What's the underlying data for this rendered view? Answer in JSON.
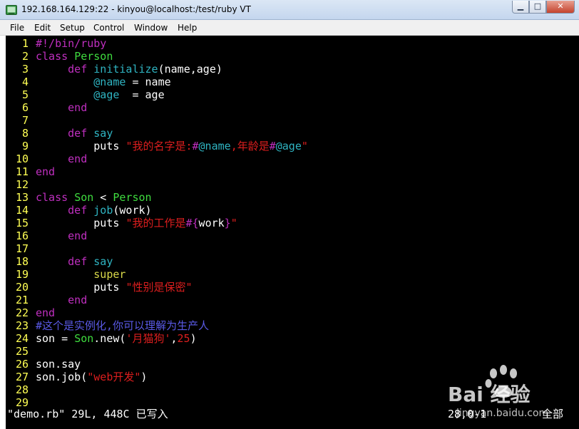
{
  "window": {
    "title": "192.168.164.129:22 - kinyou@localhost:/test/ruby VT",
    "minimize_glyph": "▁",
    "maximize_glyph": "□",
    "close_glyph": "✕",
    "app_icon": "terminal-icon"
  },
  "menu": [
    "File",
    "Edit",
    "Setup",
    "Control",
    "Window",
    "Help"
  ],
  "editor": {
    "lines": [
      {
        "n": "1",
        "spans": [
          {
            "t": "#!/bin/ruby",
            "c": "kw"
          }
        ]
      },
      {
        "n": "2",
        "spans": [
          {
            "t": "class ",
            "c": "kw"
          },
          {
            "t": "Person",
            "c": "type"
          }
        ]
      },
      {
        "n": "3",
        "spans": [
          {
            "t": "     "
          },
          {
            "t": "def ",
            "c": "kw"
          },
          {
            "t": "initialize",
            "c": "fn"
          },
          {
            "t": "(name,age)",
            "c": "dflt"
          }
        ]
      },
      {
        "n": "4",
        "spans": [
          {
            "t": "         "
          },
          {
            "t": "@name",
            "c": "ivar"
          },
          {
            "t": " = name",
            "c": "dflt"
          }
        ]
      },
      {
        "n": "5",
        "spans": [
          {
            "t": "         "
          },
          {
            "t": "@age",
            "c": "ivar"
          },
          {
            "t": "  = age",
            "c": "dflt"
          }
        ]
      },
      {
        "n": "6",
        "spans": [
          {
            "t": "     "
          },
          {
            "t": "end",
            "c": "kw"
          }
        ]
      },
      {
        "n": "7",
        "spans": []
      },
      {
        "n": "8",
        "spans": [
          {
            "t": "     "
          },
          {
            "t": "def ",
            "c": "kw"
          },
          {
            "t": "say",
            "c": "fn"
          }
        ]
      },
      {
        "n": "9",
        "spans": [
          {
            "t": "         "
          },
          {
            "t": "puts ",
            "c": "dflt"
          },
          {
            "t": "\"我的名字是:",
            "c": "str"
          },
          {
            "t": "#",
            "c": "interp"
          },
          {
            "t": "@name",
            "c": "ivar"
          },
          {
            "t": ",年龄是",
            "c": "str"
          },
          {
            "t": "#",
            "c": "interp"
          },
          {
            "t": "@age",
            "c": "ivar"
          },
          {
            "t": "\"",
            "c": "str"
          }
        ]
      },
      {
        "n": "10",
        "spans": [
          {
            "t": "     "
          },
          {
            "t": "end",
            "c": "kw"
          }
        ]
      },
      {
        "n": "11",
        "spans": [
          {
            "t": "end",
            "c": "kw"
          }
        ]
      },
      {
        "n": "12",
        "spans": []
      },
      {
        "n": "13",
        "spans": [
          {
            "t": "class ",
            "c": "kw"
          },
          {
            "t": "Son",
            "c": "type"
          },
          {
            "t": " < ",
            "c": "dflt"
          },
          {
            "t": "Person",
            "c": "type"
          }
        ]
      },
      {
        "n": "14",
        "spans": [
          {
            "t": "     "
          },
          {
            "t": "def ",
            "c": "kw"
          },
          {
            "t": "job",
            "c": "fn"
          },
          {
            "t": "(work)",
            "c": "dflt"
          }
        ]
      },
      {
        "n": "15",
        "spans": [
          {
            "t": "         "
          },
          {
            "t": "puts ",
            "c": "dflt"
          },
          {
            "t": "\"我的工作是",
            "c": "str"
          },
          {
            "t": "#{",
            "c": "interp"
          },
          {
            "t": "work",
            "c": "dflt"
          },
          {
            "t": "}",
            "c": "interp"
          },
          {
            "t": "\"",
            "c": "str"
          }
        ]
      },
      {
        "n": "16",
        "spans": [
          {
            "t": "     "
          },
          {
            "t": "end",
            "c": "kw"
          }
        ]
      },
      {
        "n": "17",
        "spans": []
      },
      {
        "n": "18",
        "spans": [
          {
            "t": "     "
          },
          {
            "t": "def ",
            "c": "kw"
          },
          {
            "t": "say",
            "c": "fn"
          }
        ]
      },
      {
        "n": "19",
        "spans": [
          {
            "t": "         "
          },
          {
            "t": "super",
            "c": "sup"
          }
        ]
      },
      {
        "n": "20",
        "spans": [
          {
            "t": "         "
          },
          {
            "t": "puts ",
            "c": "dflt"
          },
          {
            "t": "\"性别是保密\"",
            "c": "str"
          }
        ]
      },
      {
        "n": "21",
        "spans": [
          {
            "t": "     "
          },
          {
            "t": "end",
            "c": "kw"
          }
        ]
      },
      {
        "n": "22",
        "spans": [
          {
            "t": "end",
            "c": "kw"
          }
        ]
      },
      {
        "n": "23",
        "spans": [
          {
            "t": "#这个是实例化,你可以理解为生产人",
            "c": "comment"
          }
        ]
      },
      {
        "n": "24",
        "spans": [
          {
            "t": "son = ",
            "c": "dflt"
          },
          {
            "t": "Son",
            "c": "type"
          },
          {
            "t": ".new(",
            "c": "dflt"
          },
          {
            "t": "'月猫狗'",
            "c": "str"
          },
          {
            "t": ",",
            "c": "dflt"
          },
          {
            "t": "25",
            "c": "num"
          },
          {
            "t": ")",
            "c": "dflt"
          }
        ]
      },
      {
        "n": "25",
        "spans": []
      },
      {
        "n": "26",
        "spans": [
          {
            "t": "son.say",
            "c": "dflt"
          }
        ]
      },
      {
        "n": "27",
        "spans": [
          {
            "t": "son.job(",
            "c": "dflt"
          },
          {
            "t": "\"web开发\"",
            "c": "str"
          },
          {
            "t": ")",
            "c": "dflt"
          }
        ]
      },
      {
        "n": "28",
        "spans": []
      },
      {
        "n": "29",
        "spans": []
      }
    ]
  },
  "statusline": {
    "file_info": "\"demo.rb\" 29L, 448C 已写入",
    "cursor": "28,0-1",
    "scroll": "全部"
  },
  "watermark": {
    "brand": "Bai 经验",
    "url": "jingyan.baidu.com"
  },
  "colors": {
    "terminal_bg": "#000000",
    "line_number": "#ffff54",
    "keyword": "#bf2fbf",
    "type": "#3fdc3f",
    "function": "#2fb4c2",
    "string": "#dc1e1e",
    "comment": "#5a5ae6"
  }
}
